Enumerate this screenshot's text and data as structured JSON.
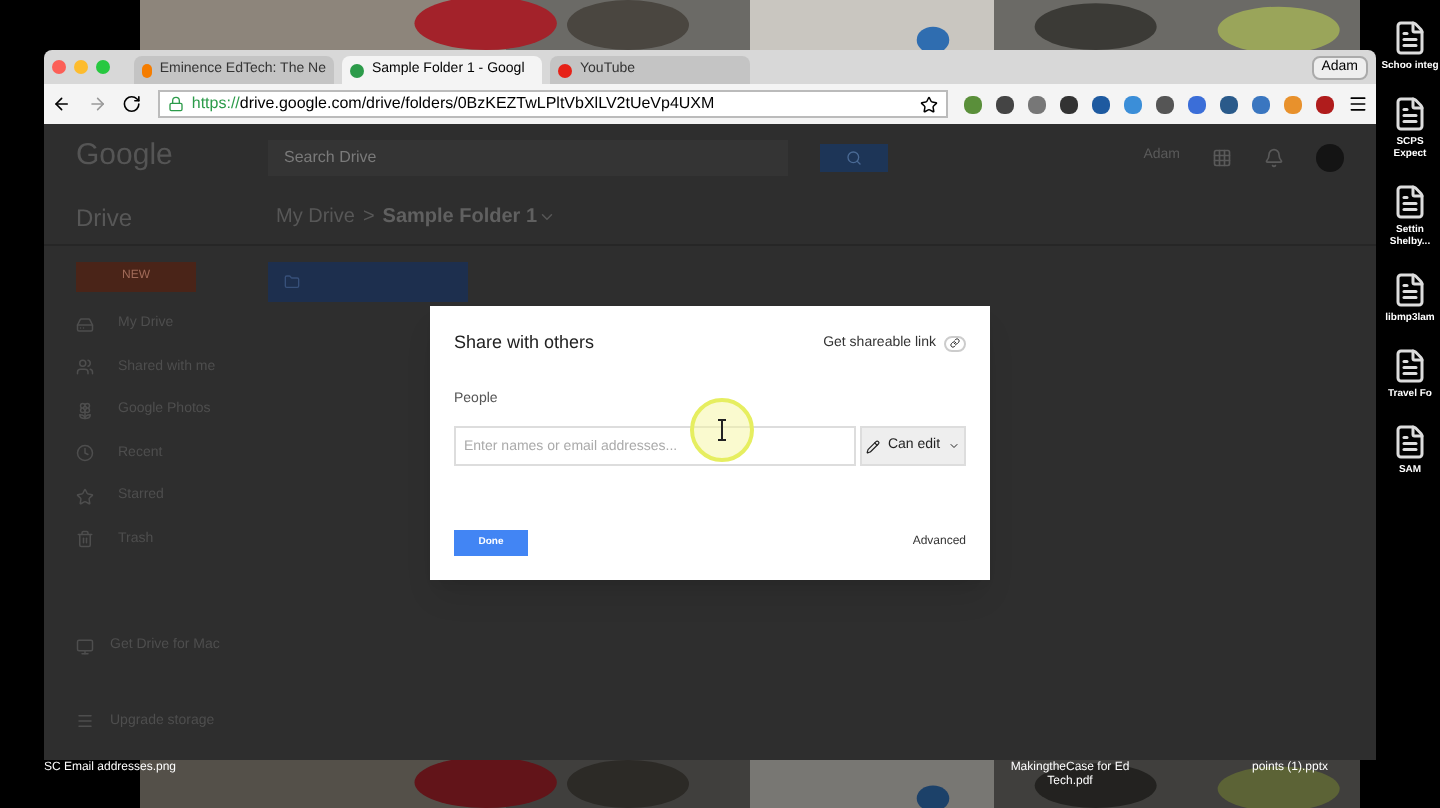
{
  "browser": {
    "tabs": [
      {
        "label": "Eminence EdTech: The Ne",
        "selected": false,
        "kind": "blogger"
      },
      {
        "label": "Sample Folder 1 - Googl",
        "selected": true,
        "kind": "drive"
      },
      {
        "label": "YouTube",
        "selected": false,
        "kind": "youtube"
      }
    ],
    "profile": "Adam",
    "url_scheme": "https://",
    "url_rest": "drive.google.com/drive/folders/0BzKEZTwLPltVbXlLV2tUeVp4UXM"
  },
  "drive": {
    "logo": "Google",
    "search": {
      "placeholder": "Search Drive"
    },
    "user": "Adam",
    "product": "Drive",
    "breadcrumb": [
      {
        "label": "My Drive",
        "current": false
      },
      {
        "label": "Sample Folder 1",
        "current": true
      }
    ],
    "separator": ">",
    "new_button": "NEW",
    "sidebar": [
      {
        "label": "My Drive",
        "kind": "drive"
      },
      {
        "label": "Shared with me",
        "kind": "shared"
      },
      {
        "label": "Google Photos",
        "kind": "photos"
      },
      {
        "label": "Recent",
        "kind": "recent"
      },
      {
        "label": "Starred",
        "kind": "star"
      },
      {
        "label": "Trash",
        "kind": "trash"
      }
    ],
    "get_app": "Get Drive for Mac",
    "upgrade": "Upgrade storage"
  },
  "dialog": {
    "title": "Share with others",
    "link": "Get shareable link",
    "people_label": "People",
    "input": {
      "placeholder": "Enter names or email addresses..."
    },
    "permission": "Can edit",
    "done": "Done",
    "advanced": "Advanced"
  },
  "desktop": {
    "right_icons": [
      {
        "label": "Schoo integ"
      },
      {
        "label": "SCPS Expect"
      },
      {
        "label": "Settin Shelby..."
      },
      {
        "label": "libmp3lam"
      },
      {
        "label": "Travel Fo"
      },
      {
        "label": "SAM"
      }
    ],
    "bottom_labels": [
      {
        "label": "SC Email addresses.png"
      },
      {
        "label": "MakingtheCase for Ed Tech.pdf"
      },
      {
        "label": "points (1).pptx"
      }
    ]
  }
}
